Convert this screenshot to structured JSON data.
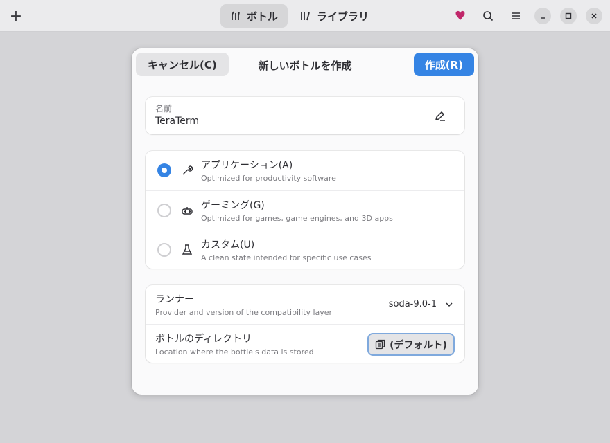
{
  "header": {
    "add_icon": "plus-icon",
    "tabs": [
      {
        "label": "ボトル",
        "icon": "bottles-icon",
        "active": true
      },
      {
        "label": "ライブラリ",
        "icon": "library-icon",
        "active": false
      }
    ],
    "actions": [
      "heart-icon",
      "search-icon",
      "menu-icon"
    ],
    "window_controls": [
      "minimize-icon",
      "maximize-icon",
      "close-icon"
    ],
    "heart_color": "#c0276a"
  },
  "dialog": {
    "cancel_label": "キャンセル(C)",
    "title": "新しいボトルを作成",
    "create_label": "作成(R)",
    "accent": "#3584e4",
    "name": {
      "label": "名前",
      "value": "TeraTerm",
      "edit_icon": "edit-icon"
    },
    "environments": [
      {
        "title": "アプリケーション(A)",
        "subtitle": "Optimized for productivity software",
        "icon": "wrench-icon",
        "selected": true
      },
      {
        "title": "ゲーミング(G)",
        "subtitle": "Optimized for games, game engines, and 3D apps",
        "icon": "gamepad-icon",
        "selected": false
      },
      {
        "title": "カスタム(U)",
        "subtitle": "A clean state intended for specific use cases",
        "icon": "flask-icon",
        "selected": false
      }
    ],
    "runner": {
      "title": "ランナー",
      "subtitle": "Provider and version of the compatibility layer",
      "value": "soda-9.0-1"
    },
    "directory": {
      "title": "ボトルのディレクトリ",
      "subtitle": "Location where the bottle's data is stored",
      "button_label": "(デフォルト)"
    }
  }
}
